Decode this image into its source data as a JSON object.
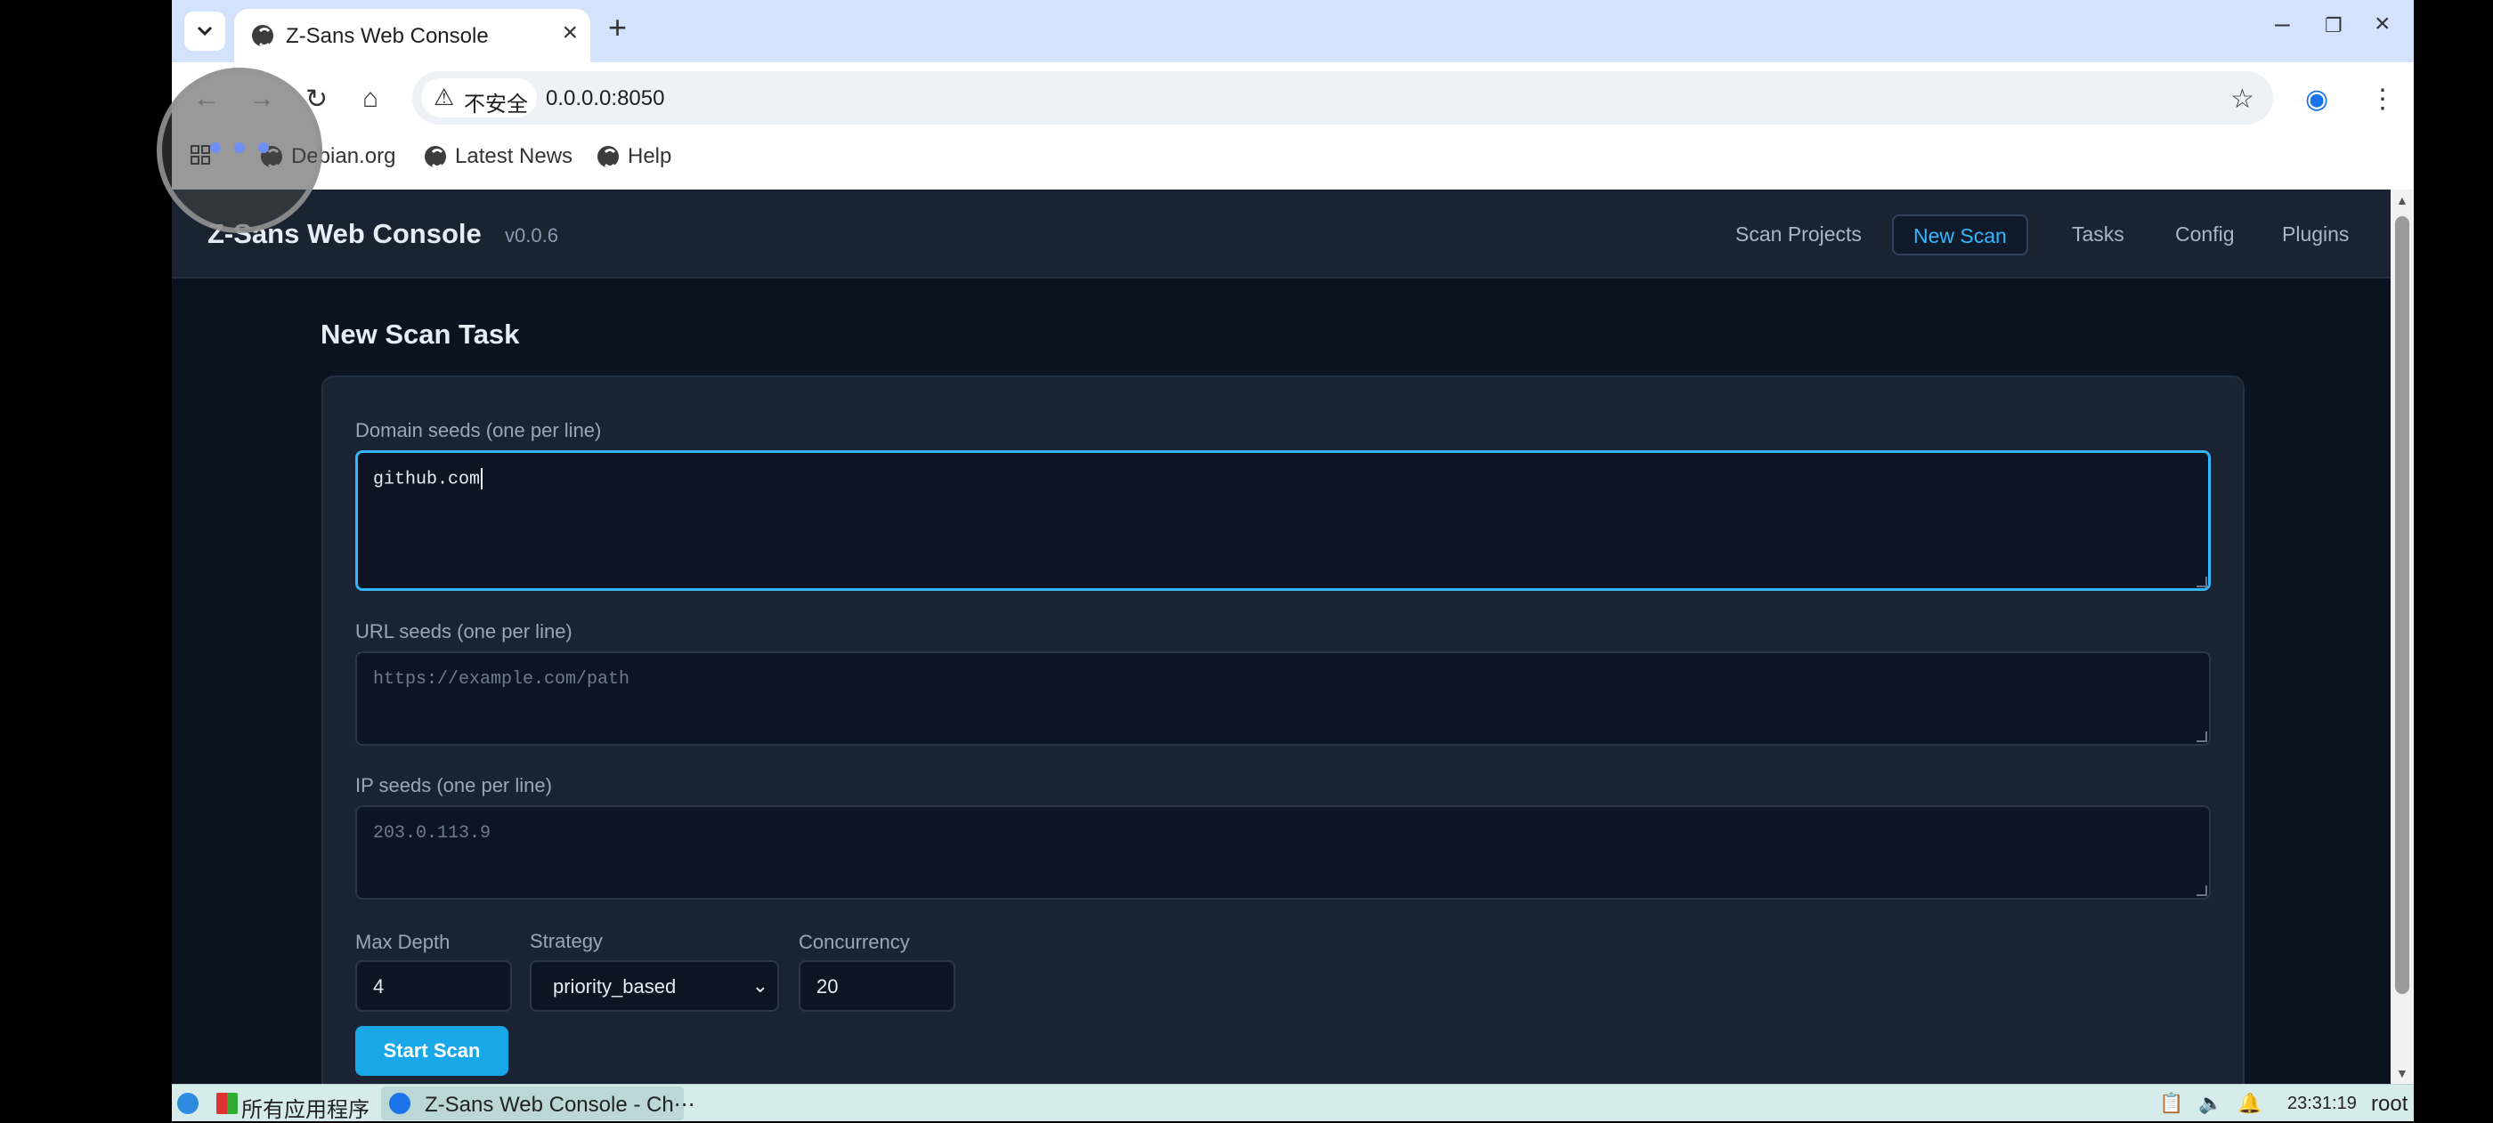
{
  "browser": {
    "tab_title": "Z-Sans Web Console",
    "security_label": "不安全",
    "url": "0.0.0.0:8050",
    "bookmarks": [
      "Debian.org",
      "Latest News",
      "Help"
    ]
  },
  "app": {
    "brand": "Z-Sans Web Console",
    "version": "v0.0.6",
    "nav": [
      "Scan Projects",
      "New Scan",
      "Tasks",
      "Config",
      "Plugins"
    ],
    "active_nav": "New Scan"
  },
  "form": {
    "heading": "New Scan Task",
    "domain_label": "Domain seeds (one per line)",
    "domain_value": "github.com",
    "url_label": "URL seeds (one per line)",
    "url_placeholder": "https://example.com/path",
    "ip_label": "IP seeds (one per line)",
    "ip_placeholder": "203.0.113.9",
    "max_depth_label": "Max Depth",
    "max_depth_value": "4",
    "strategy_label": "Strategy",
    "strategy_value": "priority_based",
    "concurrency_label": "Concurrency",
    "concurrency_value": "20",
    "submit_label": "Start Scan"
  },
  "taskbar": {
    "apps_label": "所有应用程序",
    "window_label": "Z-Sans Web Console - Ch⋯",
    "clock": "23:31:19",
    "user": "root"
  },
  "colors": {
    "accent": "#35b7ff",
    "button": "#1aa7e8",
    "page_bg": "#0b1220",
    "panel_bg": "#1a2332"
  }
}
